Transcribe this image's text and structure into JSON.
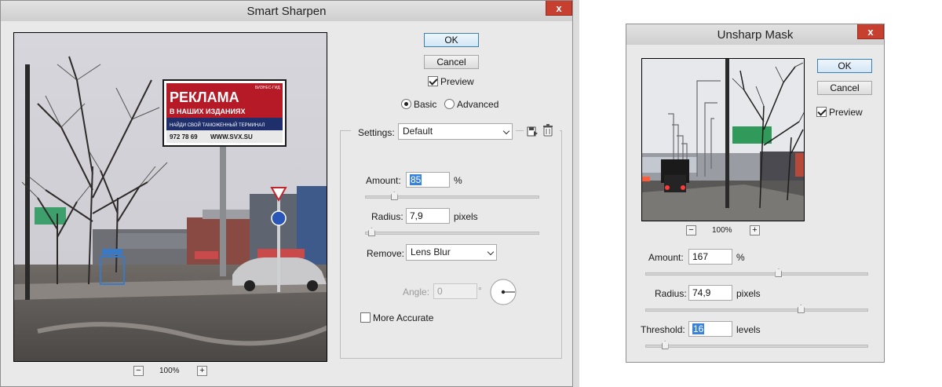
{
  "smart_sharpen": {
    "title": "Smart Sharpen",
    "close": "x",
    "ok": "OK",
    "cancel": "Cancel",
    "preview_label": "Preview",
    "preview_checked": true,
    "mode_basic": "Basic",
    "mode_advanced": "Advanced",
    "mode_selected": "Basic",
    "settings_label": "Settings:",
    "settings_value": "Default",
    "amount_label": "Amount:",
    "amount_value": "85",
    "amount_unit": "%",
    "amount_fraction": 0.17,
    "radius_label": "Radius:",
    "radius_value": "7,9",
    "radius_unit": "pixels",
    "radius_fraction": 0.04,
    "remove_label": "Remove:",
    "remove_value": "Lens Blur",
    "angle_label": "Angle:",
    "angle_value": "0",
    "angle_unit": "°",
    "more_accurate_label": "More Accurate",
    "more_accurate_checked": false,
    "zoom_minus": "−",
    "zoom_value": "100%",
    "zoom_plus": "+",
    "billboard_line1": "РЕКЛАМА",
    "billboard_line2": "В НАШИХ ИЗДАНИЯХ",
    "billboard_line3": "НАЙДИ СВОЙ ТАМОЖЕННЫЙ ТЕРМИНАЛ",
    "billboard_phone": "972 78 69",
    "billboard_site": "WWW.SVX.SU",
    "billboard_badge": "БИЗНЕС-ГИД"
  },
  "unsharp_mask": {
    "title": "Unsharp Mask",
    "close": "x",
    "ok": "OK",
    "cancel": "Cancel",
    "preview_label": "Preview",
    "preview_checked": true,
    "zoom_minus": "−",
    "zoom_value": "100%",
    "zoom_plus": "+",
    "amount_label": "Amount:",
    "amount_value": "167",
    "amount_unit": "%",
    "amount_fraction": 0.6,
    "radius_label": "Radius:",
    "radius_value": "74,9",
    "radius_unit": "pixels",
    "radius_fraction": 0.7,
    "threshold_label": "Threshold:",
    "threshold_value": "16",
    "threshold_unit": "levels",
    "threshold_fraction": 0.09
  },
  "colors": {
    "close_red": "#c7402f",
    "ok_blue_border": "#3c7fb1",
    "selection_blue": "#3a82d8",
    "billboard_red": "#b51a26"
  }
}
